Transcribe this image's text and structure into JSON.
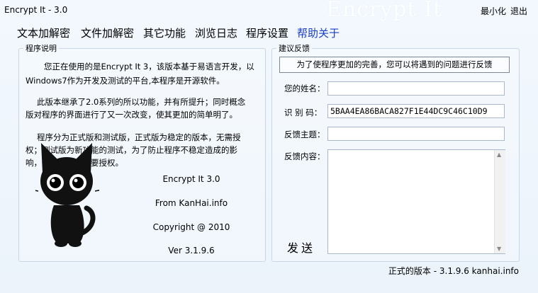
{
  "window": {
    "title": "Encrypt It - 3.0",
    "watermark": "Encrypt It",
    "minimize_label": "最小化",
    "exit_label": "退出"
  },
  "menu": [
    {
      "label": "文本加解密"
    },
    {
      "label": "文件加解密"
    },
    {
      "label": "其它功能"
    },
    {
      "label": "浏览日志"
    },
    {
      "label": "程序设置"
    },
    {
      "label": "帮助关于"
    }
  ],
  "about": {
    "group_title": "程序说明",
    "para1_line1": "您正在使用的是Encrypt It 3，该版本基于易语言开发，以",
    "para1_line2": "Windows7作为开发及测试的平台,本程序是开源软件。",
    "para2_line1": "此版本继承了2.0系列的所以功能，并有所提升；同时概念",
    "para2_line2": "版对程序的界面进行了又一次改变，使其更加的简单明了。",
    "para3_line1": "程序分为正式版和测试版，正式版为稳定的版本，无需授",
    "para3_line2": "权；测试版为新功能的测试，为了防止程序不稳定造成的影",
    "para3_line3": "响，使用测试版需要授权。",
    "product": "Encrypt It 3.0",
    "from": "From KanHai.info",
    "copyright": "Copyright @ 2010",
    "version": "Ver 3.1.9.6"
  },
  "feedback": {
    "group_title": "建议反馈",
    "notice": "为了使程序更加的完善，您可以将遇到的问题进行反馈",
    "name_label": "您的姓名：",
    "name_value": "",
    "id_label": "识 别 码：",
    "id_value": "5BAA4EA86BACA827F1E44DC9C46C10D9",
    "subject_label": "反馈主题：",
    "subject_value": "",
    "content_label": "反馈内容：",
    "content_value": "",
    "send_label": "发送"
  },
  "footer": {
    "status": "正式的版本 - 3.1.9.6 kanhai.info"
  }
}
